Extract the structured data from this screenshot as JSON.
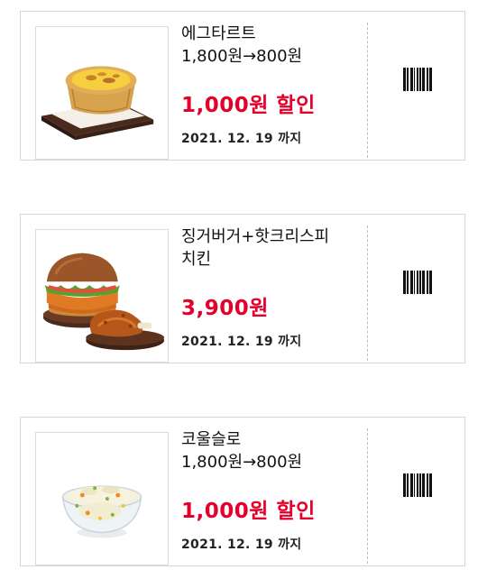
{
  "coupons": [
    {
      "name": "에그타르트\n1,800원→800원",
      "price": "1,000원 할인",
      "expiry": "2021. 12. 19 까지",
      "image": "egg-tart"
    },
    {
      "name": "징거버거+핫크리스피\n치킨",
      "price": "3,900원",
      "expiry": "2021. 12. 19 까지",
      "image": "zinger-burger-and-chicken"
    },
    {
      "name": "코울슬로\n1,800원→800원",
      "price": "1,000원 할인",
      "expiry": "2021. 12. 19 까지",
      "image": "coleslaw"
    }
  ],
  "colors": {
    "accent": "#e4002b",
    "border": "#d6d6d6",
    "text": "#111111"
  }
}
